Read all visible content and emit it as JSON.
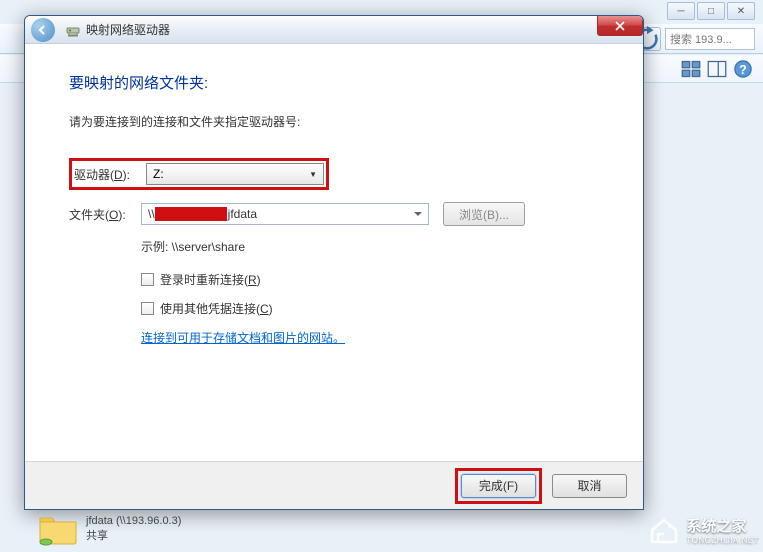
{
  "bg": {
    "search_placeholder": "搜索 193.9...",
    "footer_name": "jfdata (\\\\193.96.0.3)",
    "footer_type": "共享"
  },
  "dialog": {
    "title": "映射网络驱动器",
    "heading": "要映射的网络文件夹:",
    "instruction": "请为要连接到的连接和文件夹指定驱动器号:",
    "drive_label": "驱动器(D):",
    "drive_value": "Z:",
    "folder_label": "文件夹(O):",
    "folder_value_prefix": "\\\\",
    "folder_value_suffix": "jfdata",
    "browse_label": "浏览(B)...",
    "example": "示例: \\\\server\\share",
    "checkbox_reconnect": "登录时重新连接(R)",
    "checkbox_credentials": "使用其他凭据连接(C)",
    "link_text": "连接到可用于存储文档和图片的网站。",
    "finish_label": "完成(F)",
    "cancel_label": "取消"
  },
  "watermark": {
    "cn": "系统之家",
    "en": "TONGZHIJIA.NET"
  }
}
